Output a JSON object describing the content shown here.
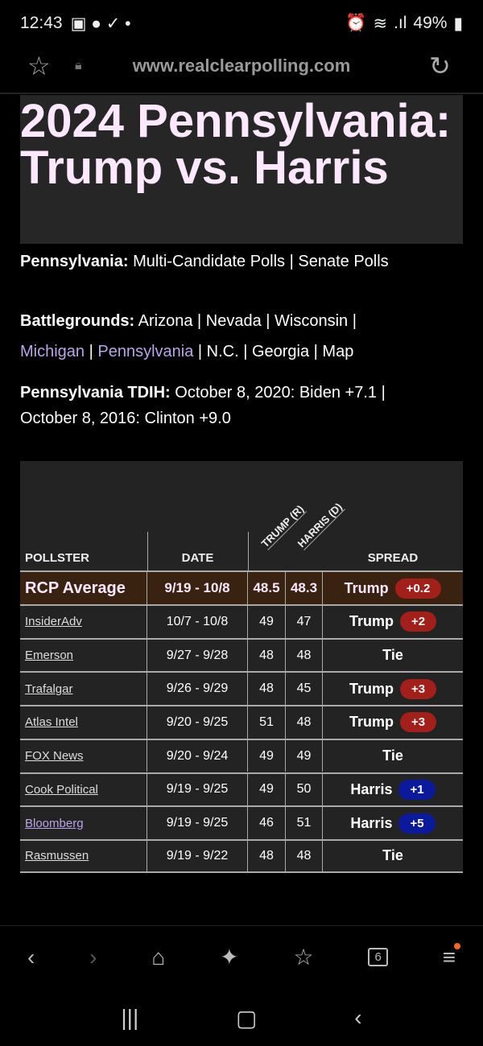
{
  "status": {
    "time": "12:43",
    "battery": "49%"
  },
  "browser": {
    "url": "www.realclearpolling.com",
    "tab_count": "6"
  },
  "title": "2024 Pennsylvania: Trump vs. Harris",
  "links": {
    "pa_label": "Pennsylvania:",
    "pa_items": [
      "Multi-Candidate Polls",
      "Senate Polls"
    ],
    "bg_label": "Battlegrounds:",
    "bg_items": [
      "Arizona",
      "Nevada",
      "Wisconsin",
      "Michigan",
      "Pennsylvania",
      "N.C.",
      "Georgia",
      "Map"
    ],
    "tdih_label": "Pennsylvania TDIH:",
    "tdih_1": "October 8, 2020: Biden +7.1",
    "tdih_2": "October 8, 2016: Clinton +9.0"
  },
  "table": {
    "headers": {
      "pollster": "POLLSTER",
      "date": "DATE",
      "trump": "TRUMP (R)",
      "harris": "HARRIS (D)",
      "spread": "SPREAD"
    },
    "average": {
      "pollster": "RCP Average",
      "date": "9/19 - 10/8",
      "trump": "48.5",
      "harris": "48.3",
      "leader": "Trump",
      "margin": "+0.2"
    },
    "rows": [
      {
        "pollster": "InsiderAdv",
        "date": "10/7 - 10/8",
        "trump": "49",
        "harris": "47",
        "leader": "Trump",
        "margin": "+2"
      },
      {
        "pollster": "Emerson",
        "date": "9/27 - 9/28",
        "trump": "48",
        "harris": "48",
        "leader": "Tie",
        "margin": ""
      },
      {
        "pollster": "Trafalgar",
        "date": "9/26 - 9/29",
        "trump": "48",
        "harris": "45",
        "leader": "Trump",
        "margin": "+3"
      },
      {
        "pollster": "Atlas Intel",
        "date": "9/20 - 9/25",
        "trump": "51",
        "harris": "48",
        "leader": "Trump",
        "margin": "+3"
      },
      {
        "pollster": "FOX News",
        "date": "9/20 - 9/24",
        "trump": "49",
        "harris": "49",
        "leader": "Tie",
        "margin": ""
      },
      {
        "pollster": "Cook Political",
        "date": "9/19 - 9/25",
        "trump": "49",
        "harris": "50",
        "leader": "Harris",
        "margin": "+1"
      },
      {
        "pollster": "Bloomberg",
        "date": "9/19 - 9/25",
        "trump": "46",
        "harris": "51",
        "leader": "Harris",
        "margin": "+5"
      },
      {
        "pollster": "Rasmussen",
        "date": "9/19 - 9/22",
        "trump": "48",
        "harris": "48",
        "leader": "Tie",
        "margin": ""
      }
    ]
  },
  "colors": {
    "republican": "#a21f1a",
    "democrat": "#0b1a9c",
    "average_row": "#3a2210",
    "title_text": "#fde8ff"
  }
}
